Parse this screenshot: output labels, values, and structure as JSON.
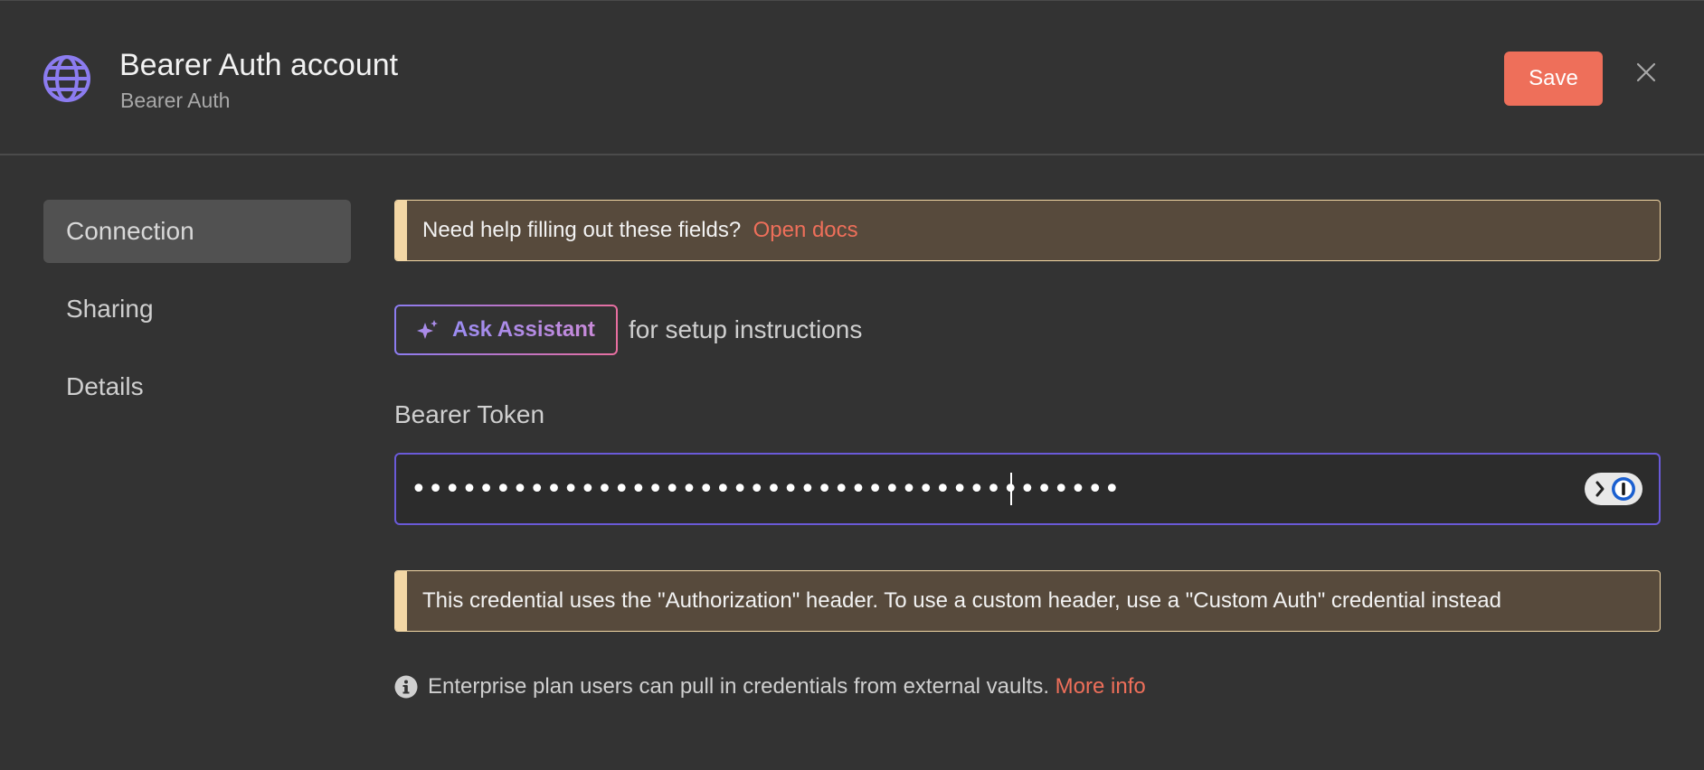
{
  "header": {
    "title": "Bearer Auth account",
    "subtitle": "Bearer Auth",
    "save_label": "Save",
    "icon": "globe-icon"
  },
  "colors": {
    "accent": "#ee6f5a",
    "brand_icon": "#8c7cf0",
    "callout_bg": "#574a3c",
    "callout_border": "#f3d7a5",
    "input_focus_border": "#6a5ad8"
  },
  "sidebar": {
    "items": [
      {
        "label": "Connection",
        "active": true
      },
      {
        "label": "Sharing",
        "active": false
      },
      {
        "label": "Details",
        "active": false
      }
    ]
  },
  "content": {
    "help_callout": {
      "text": "Need help filling out these fields?",
      "link": "Open docs"
    },
    "assistant": {
      "button_label": "Ask Assistant",
      "suffix": "for setup instructions"
    },
    "bearer_token": {
      "label": "Bearer Token",
      "value": "••••••••••••••••••••••••••••••••••••••••••"
    },
    "header_callout": {
      "text": "This credential uses the \"Authorization\" header. To use a custom header, use a \"Custom Auth\" credential instead"
    },
    "info": {
      "text": "Enterprise plan users can pull in credentials from external vaults.",
      "link": "More info"
    }
  }
}
